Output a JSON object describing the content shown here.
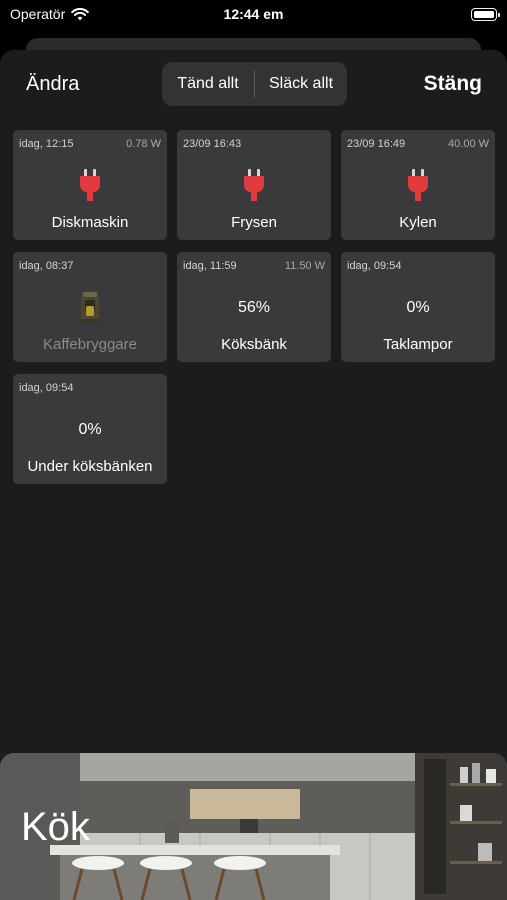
{
  "status_bar": {
    "carrier": "Operatör",
    "time": "12:44 em"
  },
  "header": {
    "edit_label": "Ändra",
    "all_on_label": "Tänd allt",
    "all_off_label": "Släck allt",
    "close_label": "Stäng"
  },
  "devices": [
    {
      "timestamp": "idag, 12:15",
      "power": "0.78 W",
      "name": "Diskmaskin",
      "icon": "plug-icon"
    },
    {
      "timestamp": "23/09 16:43",
      "power": "",
      "name": "Frysen",
      "icon": "plug-icon"
    },
    {
      "timestamp": "23/09 16:49",
      "power": "40.00 W",
      "name": "Kylen",
      "icon": "plug-icon"
    },
    {
      "timestamp": "idag, 08:37",
      "power": "",
      "name": "Kaffebryggare",
      "icon": "coffee-maker-icon"
    },
    {
      "timestamp": "idag, 11:59",
      "power": "11.50 W",
      "name": "Köksbänk",
      "level": "56%"
    },
    {
      "timestamp": "idag, 09:54",
      "power": "",
      "name": "Taklampor",
      "level": "0%"
    },
    {
      "timestamp": "idag, 09:54",
      "power": "",
      "name": "Under köksbänken",
      "level": "0%"
    }
  ],
  "room": {
    "name": "Kök"
  },
  "colors": {
    "plug": "#e0393e",
    "sheet": "#1c1c1e",
    "tile": "#3a3a3c"
  }
}
